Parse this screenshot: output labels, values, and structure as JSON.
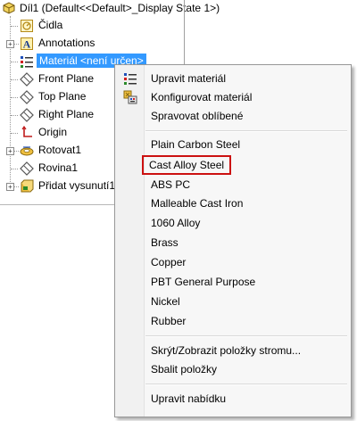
{
  "tree": {
    "root_label": "Díl1  (Default<<Default>_Display State 1>)",
    "items": [
      {
        "label": "Čidla"
      },
      {
        "label": "Annotations"
      },
      {
        "label": "Materiál <není určen>"
      },
      {
        "label": "Front Plane"
      },
      {
        "label": "Top Plane"
      },
      {
        "label": "Right Plane"
      },
      {
        "label": "Origin"
      },
      {
        "label": "Rotovat1"
      },
      {
        "label": "Rovina1"
      },
      {
        "label": "Přidat vysunutí1"
      }
    ]
  },
  "menu": {
    "group1": [
      {
        "label": "Upravit materiál"
      },
      {
        "label": "Konfigurovat materiál"
      },
      {
        "label": "Spravovat oblíbené"
      }
    ],
    "materials": [
      {
        "label": "Plain Carbon Steel"
      },
      {
        "label": "Cast Alloy Steel"
      },
      {
        "label": "ABS PC"
      },
      {
        "label": "Malleable Cast Iron"
      },
      {
        "label": "1060 Alloy"
      },
      {
        "label": "Brass"
      },
      {
        "label": "Copper"
      },
      {
        "label": "PBT General Purpose"
      },
      {
        "label": "Nickel"
      },
      {
        "label": "Rubber"
      }
    ],
    "group3": [
      {
        "label": "Skrýt/Zobrazit položky stromu..."
      },
      {
        "label": "Sbalit položky"
      }
    ],
    "group4": [
      {
        "label": "Upravit nabídku"
      }
    ]
  },
  "colors": {
    "selection": "#3399ff",
    "highlight_border": "#cc1111",
    "menu_background": "#f7f7f7"
  }
}
